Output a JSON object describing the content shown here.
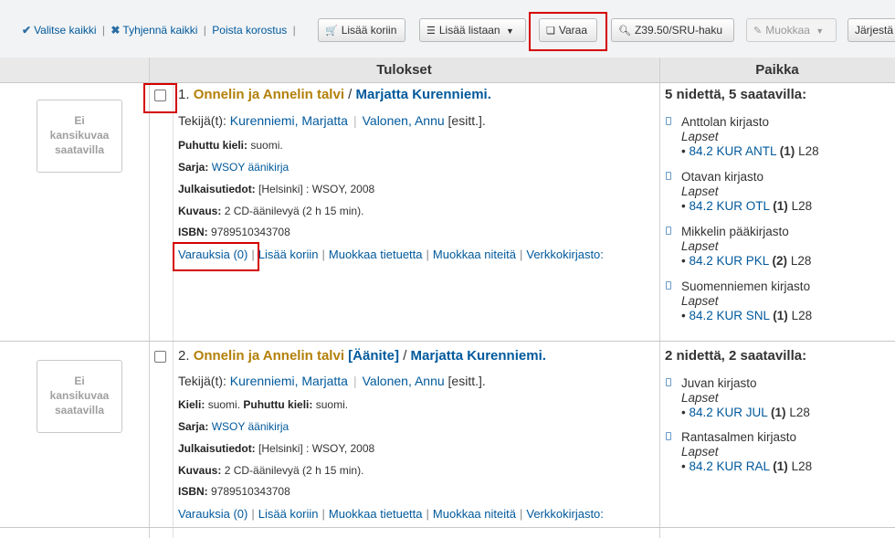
{
  "toolbar": {
    "select_all": "Valitse kaikki",
    "clear_all": "Tyhjennä kaikki",
    "remove_highlight": "Poista korostus",
    "add_to_cart": "Lisää koriin",
    "add_to_list": "Lisää listaan",
    "reserve": "Varaa",
    "z3950": "Z39.50/SRU-haku",
    "edit": "Muokkaa",
    "sort": "Järjestä"
  },
  "table": {
    "col_results": "Tulokset",
    "col_location": "Paikka"
  },
  "results": [
    {
      "cover": [
        "Ei",
        "kansikuvaa",
        "saatavilla"
      ],
      "number": "1.",
      "title": "Onnelin ja Annelin talvi",
      "medium": "",
      "slash": "/",
      "author": "Marjatta Kurenniemi.",
      "authors_label": "Tekijä(t):",
      "author1": "Kurenniemi, Marjatta",
      "author2": "Valonen, Annu",
      "author2_role": "[esitt.].",
      "lines": [
        {
          "label": "Puhuttu kieli:",
          "value": "suomi."
        },
        {
          "label": "Sarja:",
          "value": "WSOY äänikirja",
          "link": true
        },
        {
          "label": "Julkaisutiedot:",
          "value": "[Helsinki] : WSOY, 2008"
        },
        {
          "label": "Kuvaus:",
          "value": "2 CD-äänilevyä (2 h 15 min)."
        },
        {
          "label": "ISBN:",
          "value": "9789510343708"
        }
      ],
      "actions": [
        "Varauksia (0)",
        "Lisää koriin",
        "Muokkaa tietuetta",
        "Muokkaa niteitä",
        "Verkkokirjasto:"
      ],
      "availability": "5 nidettä, 5 saatavilla:",
      "libraries": [
        {
          "name": "Anttolan kirjasto",
          "collection": "Lapset",
          "callno": "84.2 KUR ANTL",
          "count": "(1)",
          "shelf": "L28"
        },
        {
          "name": "Otavan kirjasto",
          "collection": "Lapset",
          "callno": "84.2 KUR OTL",
          "count": "(1)",
          "shelf": "L28"
        },
        {
          "name": "Mikkelin pääkirjasto",
          "collection": "Lapset",
          "callno": "84.2 KUR PKL",
          "count": "(2)",
          "shelf": "L28"
        },
        {
          "name": "Suomenniemen kirjasto",
          "collection": "Lapset",
          "callno": "84.2 KUR SNL",
          "count": "(1)",
          "shelf": "L28"
        }
      ]
    },
    {
      "cover": [
        "Ei",
        "kansikuvaa",
        "saatavilla"
      ],
      "number": "2.",
      "title": "Onnelin ja Annelin talvi",
      "medium": "[Äänite]",
      "slash": "/",
      "author": "Marjatta Kurenniemi.",
      "authors_label": "Tekijä(t):",
      "author1": "Kurenniemi, Marjatta",
      "author2": "Valonen, Annu",
      "author2_role": "[esitt.].",
      "lang_label": "Kieli:",
      "lang_value": "suomi.",
      "lines": [
        {
          "label": "Puhuttu kieli:",
          "value": "suomi."
        },
        {
          "label": "Sarja:",
          "value": "WSOY äänikirja",
          "link": true
        },
        {
          "label": "Julkaisutiedot:",
          "value": "[Helsinki] : WSOY, 2008"
        },
        {
          "label": "Kuvaus:",
          "value": "2 CD-äänilevyä (2 h 15 min)."
        },
        {
          "label": "ISBN:",
          "value": "9789510343708"
        }
      ],
      "actions": [
        "Varauksia (0)",
        "Lisää koriin",
        "Muokkaa tietuetta",
        "Muokkaa niteitä",
        "Verkkokirjasto:"
      ],
      "availability": "2 nidettä, 2 saatavilla:",
      "libraries": [
        {
          "name": "Juvan kirjasto",
          "collection": "Lapset",
          "callno": "84.2 KUR JUL",
          "count": "(1)",
          "shelf": "L28"
        },
        {
          "name": "Rantasalmen kirjasto",
          "collection": "Lapset",
          "callno": "84.2 KUR RAL",
          "count": "(1)",
          "shelf": "L28"
        }
      ]
    }
  ]
}
